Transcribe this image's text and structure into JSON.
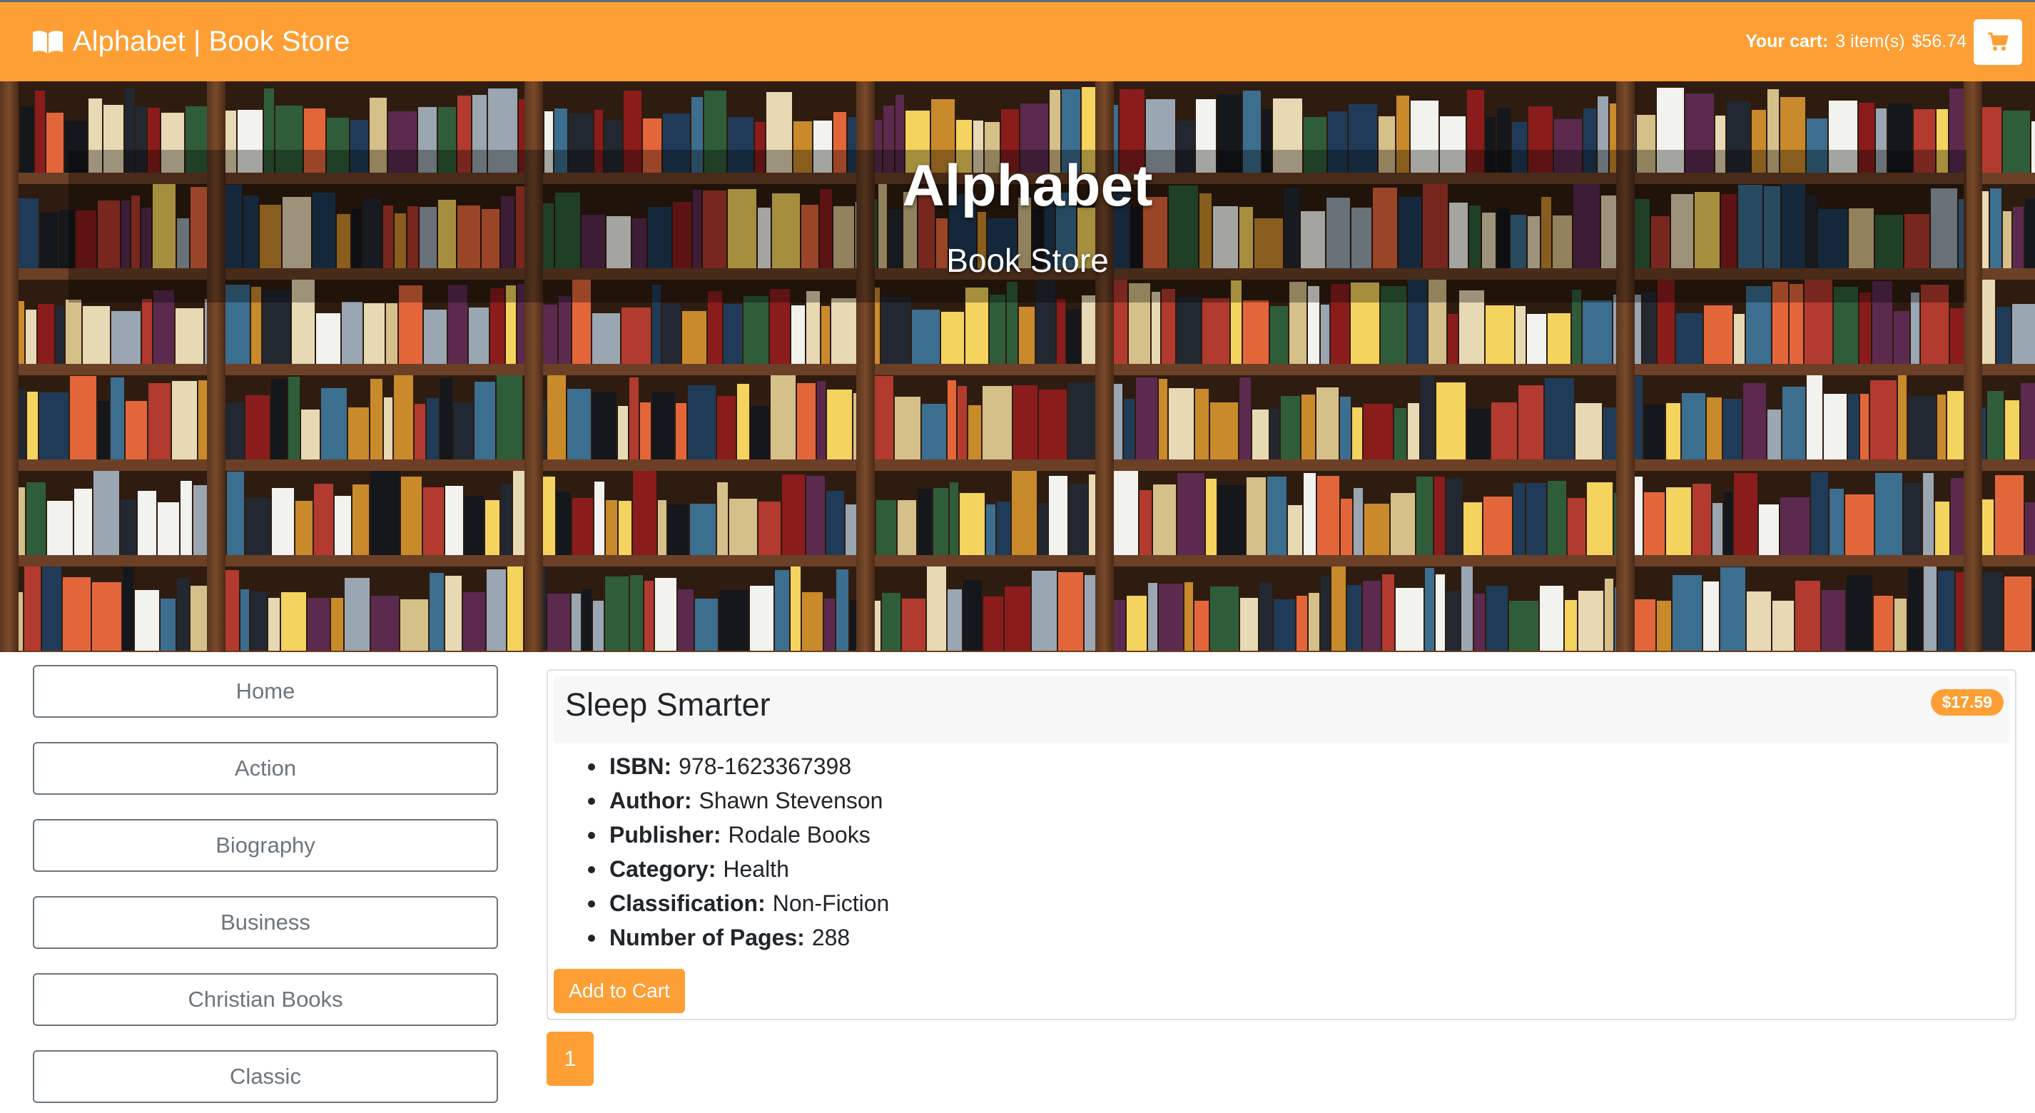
{
  "navbar": {
    "brand": "Alphabet | Book Store",
    "brand_icon": "open-book-icon",
    "cart_prefix": "Your cart:",
    "cart_count": "3 item(s)",
    "cart_total": "$56.74",
    "cart_icon": "shopping-cart-icon",
    "background_color": "#fd9f35"
  },
  "hero": {
    "title": "Alphabet",
    "subtitle": "Book Store"
  },
  "sidebar": {
    "items": [
      {
        "label": "Home"
      },
      {
        "label": "Action"
      },
      {
        "label": "Biography"
      },
      {
        "label": "Business"
      },
      {
        "label": "Christian Books"
      },
      {
        "label": "Classic"
      }
    ]
  },
  "product": {
    "title": "Sleep Smarter",
    "price": "$17.59",
    "details": [
      {
        "label": "ISBN:",
        "value": "978-1623367398"
      },
      {
        "label": "Author:",
        "value": "Shawn Stevenson"
      },
      {
        "label": "Publisher:",
        "value": "Rodale Books"
      },
      {
        "label": "Category:",
        "value": "Health"
      },
      {
        "label": "Classification:",
        "value": "Non-Fiction"
      },
      {
        "label": "Number of Pages:",
        "value": "288"
      }
    ],
    "add_to_cart_label": "Add to Cart"
  },
  "pagination": {
    "current_page": "1"
  },
  "colors": {
    "accent": "#fd9f35",
    "outline_button": "#6c757d"
  }
}
